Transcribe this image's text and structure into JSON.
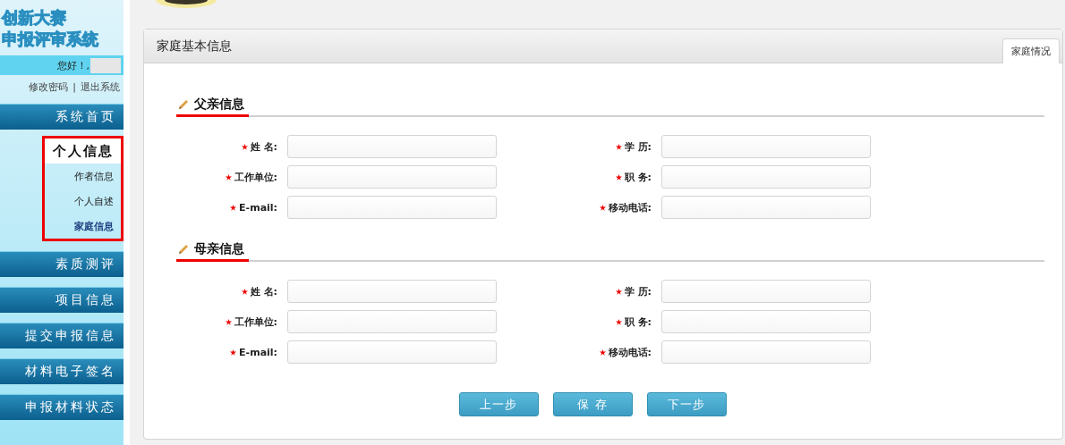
{
  "sidebar": {
    "logo_lines": [
      "创新大赛",
      "申报评审系统"
    ],
    "greeting": "您好！,",
    "links": [
      "修改密码",
      "|",
      "退出系统"
    ],
    "nav": [
      {
        "label": "系统首页",
        "expanded": false
      },
      {
        "label": "个人信息",
        "expanded": true,
        "highlighted": true,
        "children": [
          {
            "label": "作者信息",
            "selected": false
          },
          {
            "label": "个人自述",
            "selected": false
          },
          {
            "label": "家庭信息",
            "selected": true
          }
        ]
      },
      {
        "label": "素质测评",
        "expanded": false
      },
      {
        "label": "项目信息",
        "expanded": false
      },
      {
        "label": "提交申报信息",
        "expanded": false
      },
      {
        "label": "材料电子签名",
        "expanded": false
      },
      {
        "label": "申报材料状态",
        "expanded": false
      }
    ]
  },
  "panel": {
    "title": "家庭基本信息",
    "tabs": [
      {
        "label": "家庭情况",
        "selected": true
      }
    ],
    "sections": [
      {
        "title": "父亲信息",
        "fields": [
          {
            "label": "姓 名:",
            "required": true
          },
          {
            "label": "学 历:",
            "required": true
          },
          {
            "label": "工作单位:",
            "required": true
          },
          {
            "label": "职 务:",
            "required": true
          },
          {
            "label": "E-mail:",
            "required": true
          },
          {
            "label": "移动电话:",
            "required": true
          }
        ]
      },
      {
        "title": "母亲信息",
        "fields": [
          {
            "label": "姓 名:",
            "required": true
          },
          {
            "label": "学 历:",
            "required": true
          },
          {
            "label": "工作单位:",
            "required": true
          },
          {
            "label": "职 务:",
            "required": true
          },
          {
            "label": "E-mail:",
            "required": true
          },
          {
            "label": "移动电话:",
            "required": true
          }
        ]
      }
    ],
    "buttons": [
      "上一步",
      "保 存",
      "下一步"
    ]
  }
}
